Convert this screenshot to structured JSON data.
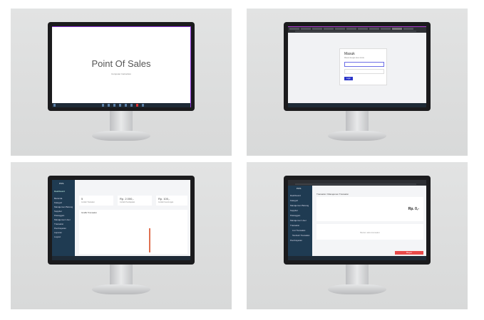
{
  "panels": {
    "p1": {
      "title": "Point Of Sales",
      "subtitle": "Computer Instruction"
    },
    "p2": {
      "login_title": "Masuk",
      "login_sub": "Masuk dengan akun Anda",
      "login_button": "Login"
    },
    "p3": {
      "brand": "POS",
      "section": "Dashboard",
      "cards": [
        {
          "value": "5",
          "label": "Jumlah Transaksi"
        },
        {
          "value": "Rp. 2.000,-",
          "label": "Jumlah Pendapatan"
        },
        {
          "value": "Rp. 100,-",
          "label": "Jumlah Keuntungan"
        }
      ],
      "chart_title": "Grafik Transaksi",
      "menu": [
        "Beranda",
        "Kategori",
        "Manajemen Barang",
        "Supplier",
        "Pelanggan",
        "Manajemen User",
        "Transaksi",
        "Pembayaran",
        "Laporan",
        "Logout"
      ]
    },
    "p4": {
      "brand": "POS",
      "breadcrumb": "Transaksi / Manajemen Transaksi",
      "total_label": "Rp. 0,-",
      "pay_button": "Bayar",
      "table_empty": "Belum ada transaksi",
      "menu": [
        "Dashboard",
        "Kategori",
        "Manajemen Barang",
        "Supplier",
        "Pelanggan",
        "Manajemen User",
        "Transaksi",
        "List Transaksi",
        "Tambah Transaksi",
        "Pembayaran"
      ]
    }
  }
}
